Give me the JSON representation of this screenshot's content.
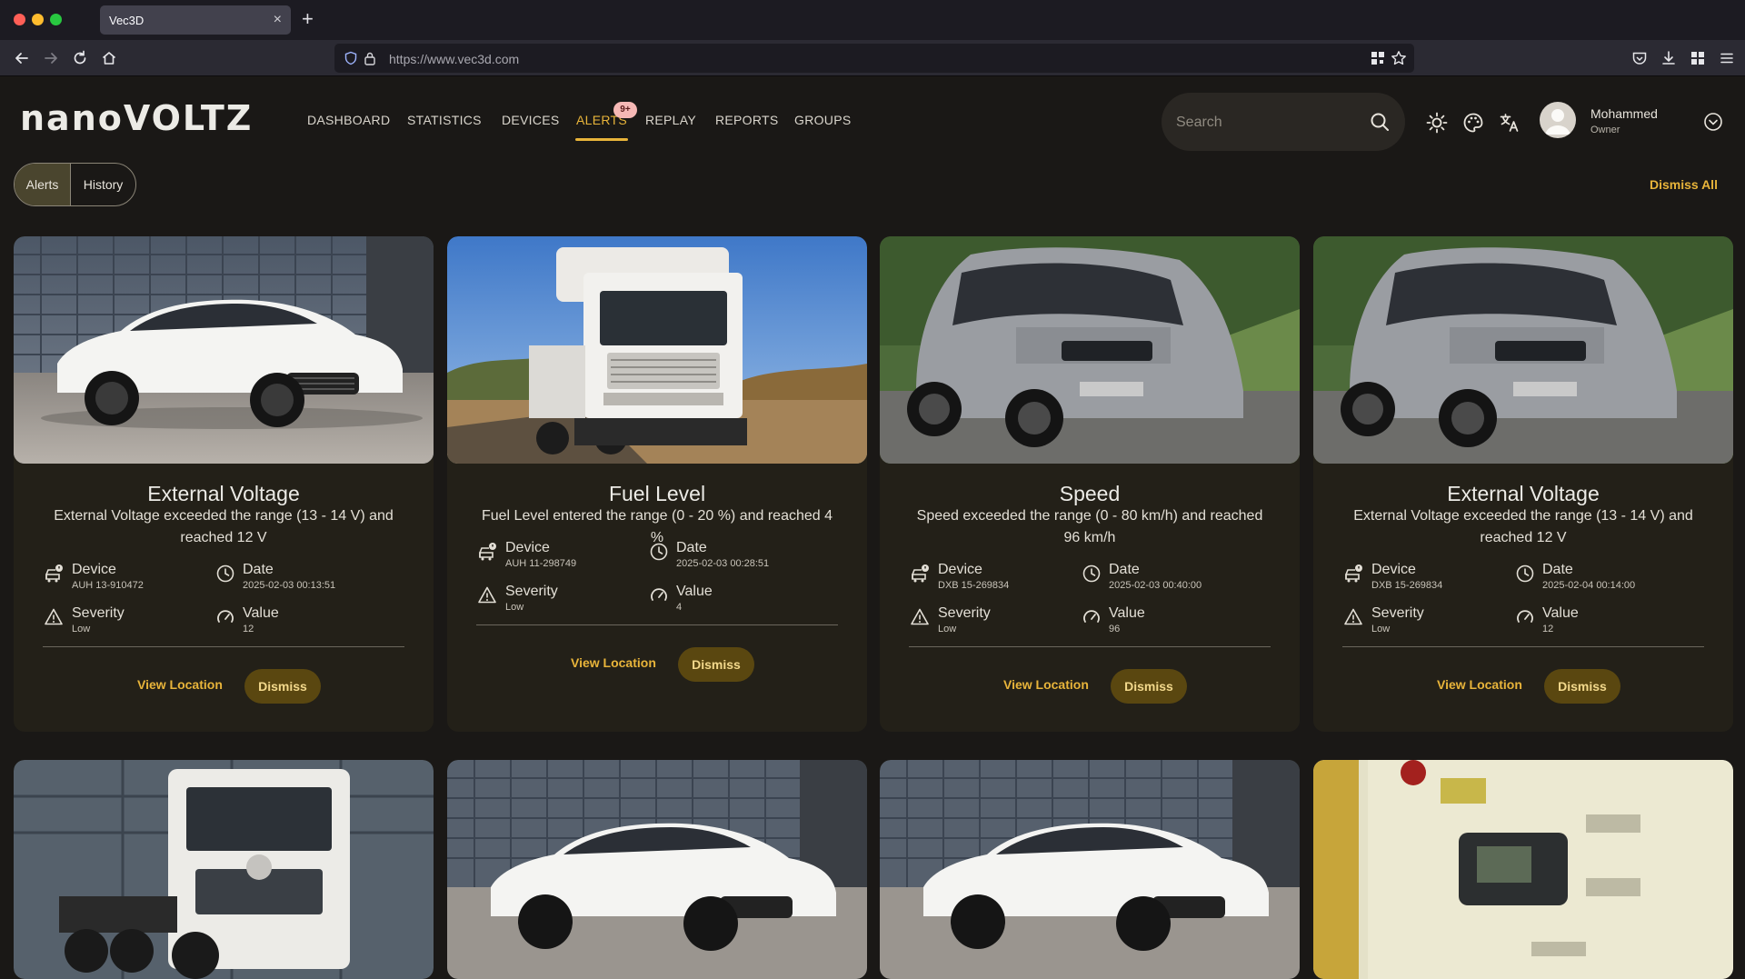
{
  "browser": {
    "tab_title": "Vec3D",
    "url": "https://www.vec3d.com"
  },
  "app": {
    "logo": "nanoVOLTZ",
    "nav": [
      "DASHBOARD",
      "STATISTICS",
      "DEVICES",
      "ALERTS",
      "REPLAY",
      "REPORTS",
      "GROUPS"
    ],
    "active_nav": "ALERTS",
    "alerts_badge": "9+",
    "search_placeholder": "Search",
    "user": {
      "name": "Mohammed",
      "role": "Owner"
    }
  },
  "toggle": {
    "alerts": "Alerts",
    "history": "History"
  },
  "dismiss_all": "Dismiss All",
  "labels": {
    "device": "Device",
    "date": "Date",
    "severity": "Severity",
    "value": "Value",
    "view_location": "View Location",
    "dismiss": "Dismiss"
  },
  "cards": [
    {
      "image": "white-sedan",
      "title": "External Voltage",
      "description": "External Voltage exceeded the range (13 - 14 V) and reached 12 V",
      "device": "AUH 13-910472",
      "date": "2025-02-03 00:13:51",
      "severity": "Low",
      "value": "12"
    },
    {
      "image": "white-truck",
      "title": "Fuel Level",
      "description": "Fuel Level entered the range (0 - 20 %) and reached 4 %",
      "device": "AUH 11-298749",
      "date": "2025-02-03 00:28:51",
      "severity": "Low",
      "value": "4"
    },
    {
      "image": "grey-van",
      "title": "Speed",
      "description": "Speed exceeded the range (0 - 80 km/h) and reached 96 km/h",
      "device": "DXB 15-269834",
      "date": "2025-02-03 00:40:00",
      "severity": "Low",
      "value": "96"
    },
    {
      "image": "grey-van",
      "title": "External Voltage",
      "description": "External Voltage exceeded the range (13 - 14 V) and reached 12 V",
      "device": "DXB 15-269834",
      "date": "2025-02-04 00:14:00",
      "severity": "Low",
      "value": "12"
    }
  ],
  "second_row_images": [
    "white-truck-chassis",
    "white-sedan",
    "white-sedan",
    "generator"
  ],
  "colors": {
    "accent": "#e8b43a",
    "background": "#1a1816",
    "card": "#232018",
    "dismiss_button": "#5a4710",
    "badge": "#f6b8b5"
  }
}
